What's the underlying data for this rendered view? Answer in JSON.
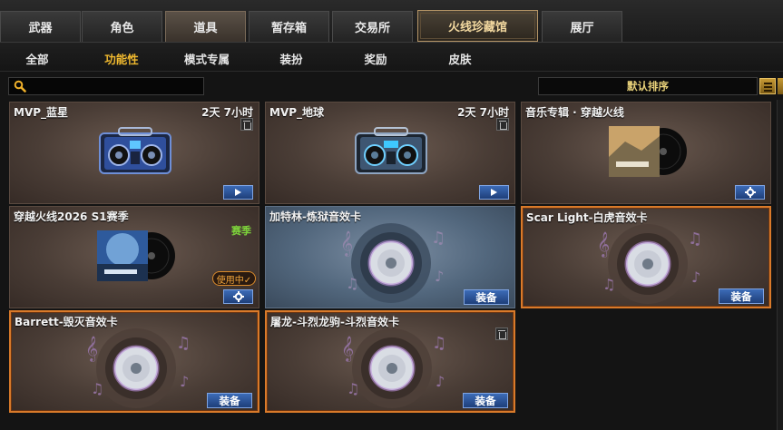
{
  "top_tabs": [
    {
      "label": "武器"
    },
    {
      "label": "角色"
    },
    {
      "label": "道具",
      "active": true
    },
    {
      "label": "暂存箱"
    },
    {
      "label": "交易所"
    },
    {
      "label": "火线珍藏馆",
      "special": true
    },
    {
      "label": "展厅"
    }
  ],
  "sub_tabs": [
    {
      "label": "全部"
    },
    {
      "label": "功能性",
      "active": true
    },
    {
      "label": "模式专属"
    },
    {
      "label": "装扮"
    },
    {
      "label": "奖励"
    },
    {
      "label": "皮肤"
    }
  ],
  "search": {
    "value": "",
    "placeholder": ""
  },
  "sort": {
    "label": "默认排序"
  },
  "items": [
    {
      "title": "MVP_蓝星",
      "time": "2天 7小时",
      "kind": "boombox",
      "boombox_color": "#3a5fb0",
      "trash": true,
      "action": "play"
    },
    {
      "title": "MVP_地球",
      "time": "2天 7小时",
      "kind": "boombox",
      "boombox_color": "#4f6b8c",
      "trash": true,
      "action": "play"
    },
    {
      "title": "音乐专辑 · 穿越火线",
      "kind": "album",
      "album_tone": "#c9a36a",
      "action": "gear"
    },
    {
      "title": "穿越火线2026 S1赛季",
      "kind": "album",
      "album_tone": "#4f7fc1",
      "season_badge": "赛季",
      "in_use": "使用中✓",
      "action": "gear"
    },
    {
      "title": "加特林-炼狱音效卡",
      "kind": "disc",
      "tone": "blue",
      "action": "equip",
      "action_label": "装备"
    },
    {
      "title": "Scar Light-白虎音效卡",
      "kind": "disc",
      "selected": true,
      "action": "equip",
      "action_label": "装备"
    },
    {
      "title": "Barrett-毁灭音效卡",
      "kind": "disc",
      "selected": true,
      "action": "equip",
      "action_label": "装备"
    },
    {
      "title": "屠龙-斗烈龙驹-斗烈音效卡",
      "kind": "disc",
      "selected": true,
      "trash": true,
      "action": "equip",
      "action_label": "装备"
    }
  ]
}
